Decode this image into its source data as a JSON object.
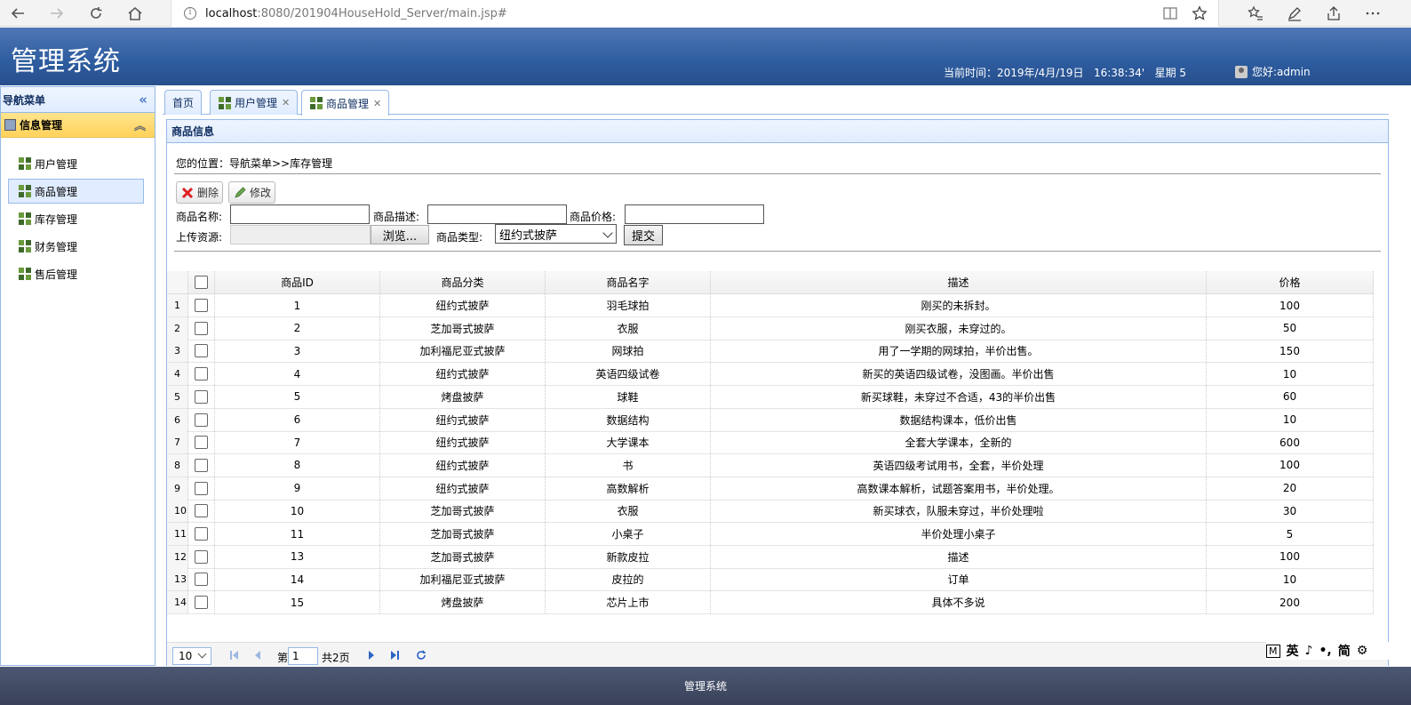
{
  "browser": {
    "url_host": "localhost",
    "url_rest": ":8080/201904HouseHold_Server/main.jsp#"
  },
  "header": {
    "title": "管理系统",
    "time": "当前时间：2019年/4月/19日   16:38:34'   星期 5",
    "user": "您好:admin"
  },
  "nav": {
    "title": "导航菜单",
    "group": "信息管理",
    "items": [
      "用户管理",
      "商品管理",
      "库存管理",
      "财务管理",
      "售后管理"
    ]
  },
  "tabs": [
    "首页",
    "用户管理",
    "商品管理"
  ],
  "panel": {
    "title": "商品信息",
    "breadcrumb": "您的位置：导航菜单>>库存管理",
    "delete_label": "删除",
    "edit_label": "修改",
    "name_label": "商品名称:",
    "desc_label": "商品描述:",
    "price_label": "商品价格:",
    "upload_label": "上传资源:",
    "browse_label": "浏览...",
    "type_label": "商品类型:",
    "type_value": "纽约式披萨",
    "submit_label": "提交"
  },
  "grid": {
    "columns": [
      "商品ID",
      "商品分类",
      "商品名字",
      "描述",
      "价格"
    ],
    "rows": [
      [
        "1",
        "纽约式披萨",
        "羽毛球拍",
        "刚买的未拆封。",
        "100"
      ],
      [
        "2",
        "芝加哥式披萨",
        "衣服",
        "刚买衣服，未穿过的。",
        "50"
      ],
      [
        "3",
        "加利福尼亚式披萨",
        "网球拍",
        "用了一学期的网球拍，半价出售。",
        "150"
      ],
      [
        "4",
        "纽约式披萨",
        "英语四级试卷",
        "新买的英语四级试卷，没图画。半价出售",
        "10"
      ],
      [
        "5",
        "烤盘披萨",
        "球鞋",
        "新买球鞋，未穿过不合适，43的半价出售",
        "60"
      ],
      [
        "6",
        "纽约式披萨",
        "数据结构",
        "数据结构课本，低价出售",
        "10"
      ],
      [
        "7",
        "纽约式披萨",
        "大学课本",
        "全套大学课本，全新的",
        "600"
      ],
      [
        "8",
        "纽约式披萨",
        "书",
        "英语四级考试用书，全套，半价处理",
        "100"
      ],
      [
        "9",
        "纽约式披萨",
        "高数解析",
        "高数课本解析，试题答案用书，半价处理。",
        "20"
      ],
      [
        "10",
        "芝加哥式披萨",
        "衣服",
        "新买球衣，队服未穿过，半价处理啦",
        "30"
      ],
      [
        "11",
        "芝加哥式披萨",
        "小桌子",
        "半价处理小桌子",
        "5"
      ],
      [
        "13",
        "芝加哥式披萨",
        "新款皮拉",
        "描述",
        "100"
      ],
      [
        "14",
        "加利福尼亚式披萨",
        "皮拉的",
        "订单",
        "10"
      ],
      [
        "15",
        "烤盘披萨",
        "芯片上市",
        "具体不多说",
        "200"
      ]
    ]
  },
  "pager": {
    "page_size": "10",
    "page_prefix": "第",
    "page_number": "1",
    "page_total": "共2页"
  },
  "ime": [
    "英",
    "简"
  ],
  "footer": "管理系统"
}
